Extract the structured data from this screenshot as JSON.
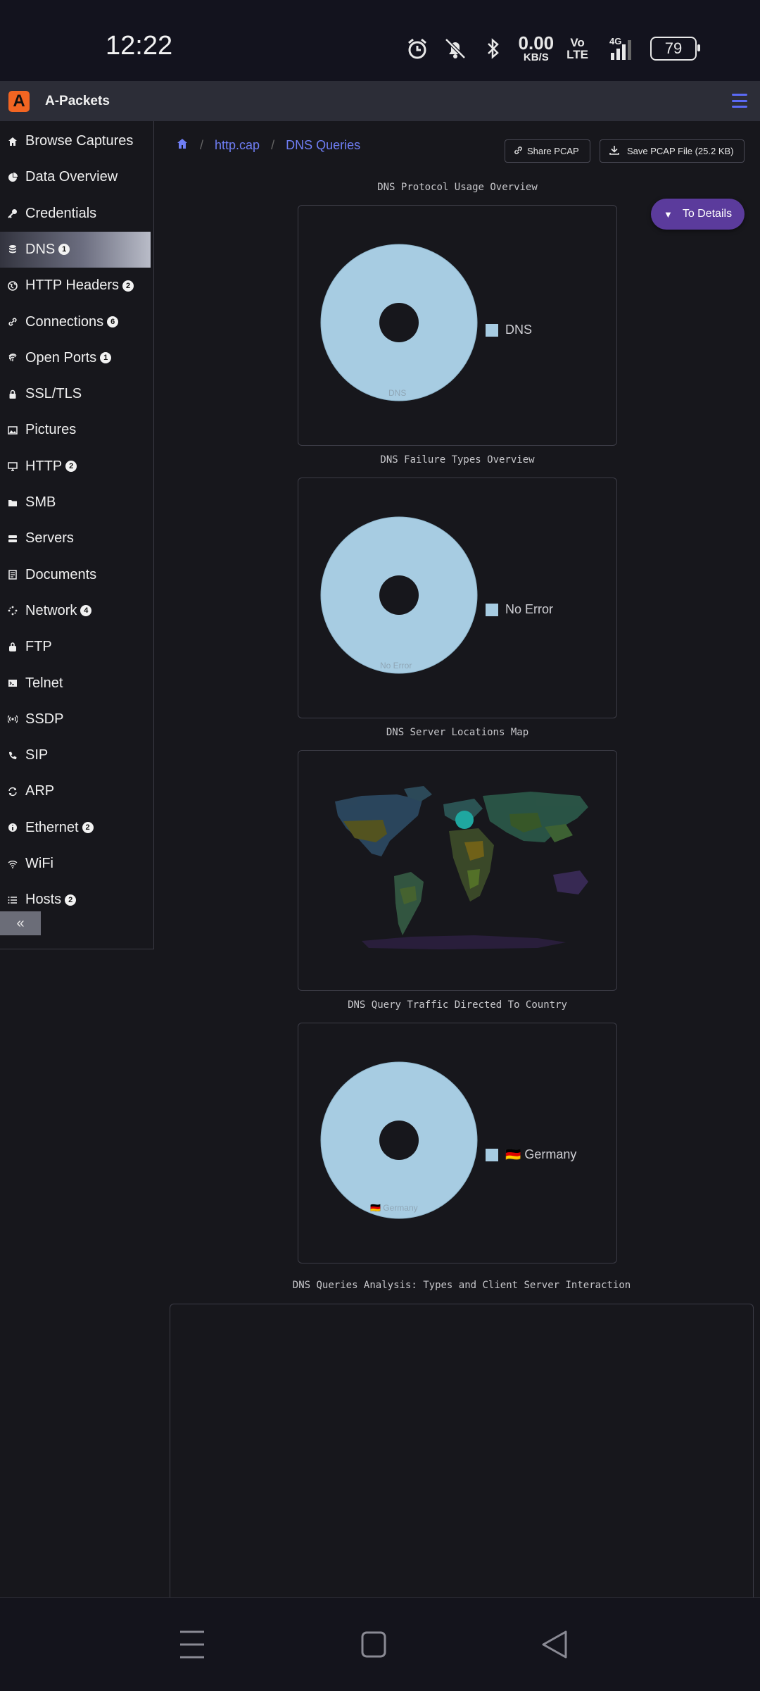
{
  "status": {
    "time": "12:22",
    "net_speed": "0.00",
    "net_unit": "KB/S",
    "volte": "Vo LTE",
    "network": "4G",
    "battery": "79"
  },
  "app": {
    "title": "A-Packets"
  },
  "sidebar": {
    "items": [
      {
        "label": "Browse Captures",
        "icon": "home-icon",
        "badge": ""
      },
      {
        "label": "Data Overview",
        "icon": "pie-chart-icon",
        "badge": ""
      },
      {
        "label": "Credentials",
        "icon": "key-icon",
        "badge": ""
      },
      {
        "label": "DNS",
        "icon": "database-icon",
        "badge": "1"
      },
      {
        "label": "HTTP Headers",
        "icon": "globe-icon",
        "badge": "2"
      },
      {
        "label": "Connections",
        "icon": "link-icon",
        "badge": "6"
      },
      {
        "label": "Open Ports",
        "icon": "fingerprint-icon",
        "badge": "1"
      },
      {
        "label": "SSL/TLS",
        "icon": "lock-icon",
        "badge": ""
      },
      {
        "label": "Pictures",
        "icon": "image-icon",
        "badge": ""
      },
      {
        "label": "HTTP",
        "icon": "monitor-icon",
        "badge": "2"
      },
      {
        "label": "SMB",
        "icon": "folder-icon",
        "badge": ""
      },
      {
        "label": "Servers",
        "icon": "server-icon",
        "badge": ""
      },
      {
        "label": "Documents",
        "icon": "document-icon",
        "badge": ""
      },
      {
        "label": "Network",
        "icon": "network-icon",
        "badge": "4"
      },
      {
        "label": "FTP",
        "icon": "bag-icon",
        "badge": ""
      },
      {
        "label": "Telnet",
        "icon": "terminal-icon",
        "badge": ""
      },
      {
        "label": "SSDP",
        "icon": "broadcast-icon",
        "badge": ""
      },
      {
        "label": "SIP",
        "icon": "phone-icon",
        "badge": ""
      },
      {
        "label": "ARP",
        "icon": "refresh-icon",
        "badge": ""
      },
      {
        "label": "Ethernet",
        "icon": "info-icon",
        "badge": "2"
      },
      {
        "label": "WiFi",
        "icon": "wifi-icon",
        "badge": ""
      },
      {
        "label": "Hosts",
        "icon": "list-icon",
        "badge": "2"
      }
    ],
    "active_index": 3,
    "collapse_label": "«"
  },
  "breadcrumb": {
    "file": "http.cap",
    "current": "DNS Queries"
  },
  "actions": {
    "share": "Share PCAP",
    "save": "Save PCAP File (25.2 KB)",
    "to_details": "To Details"
  },
  "charts": {
    "protocol": {
      "title": "DNS Protocol Usage Overview",
      "legend": "DNS",
      "slice_label": "DNS"
    },
    "failures": {
      "title": "DNS Failure Types Overview",
      "legend": "No Error",
      "slice_label": "No Error"
    },
    "map": {
      "title": "DNS Server Locations Map"
    },
    "country": {
      "title": "DNS Query Traffic Directed To Country",
      "legend": "🇩🇪 Germany",
      "slice_label": "🇩🇪 Germany"
    },
    "analysis": {
      "title": "DNS Queries Analysis: Types and Client Server Interaction"
    }
  },
  "chart_data": [
    {
      "type": "pie",
      "title": "DNS Protocol Usage Overview",
      "categories": [
        "DNS"
      ],
      "values": [
        100
      ]
    },
    {
      "type": "pie",
      "title": "DNS Failure Types Overview",
      "categories": [
        "No Error"
      ],
      "values": [
        100
      ]
    },
    {
      "type": "pie",
      "title": "DNS Query Traffic Directed To Country",
      "categories": [
        "Germany"
      ],
      "values": [
        100
      ]
    }
  ],
  "colors": {
    "accent": "#6f7ef5",
    "slice": "#a7cce2",
    "to_details": "#5b3b9c",
    "brand": "#f26522"
  }
}
